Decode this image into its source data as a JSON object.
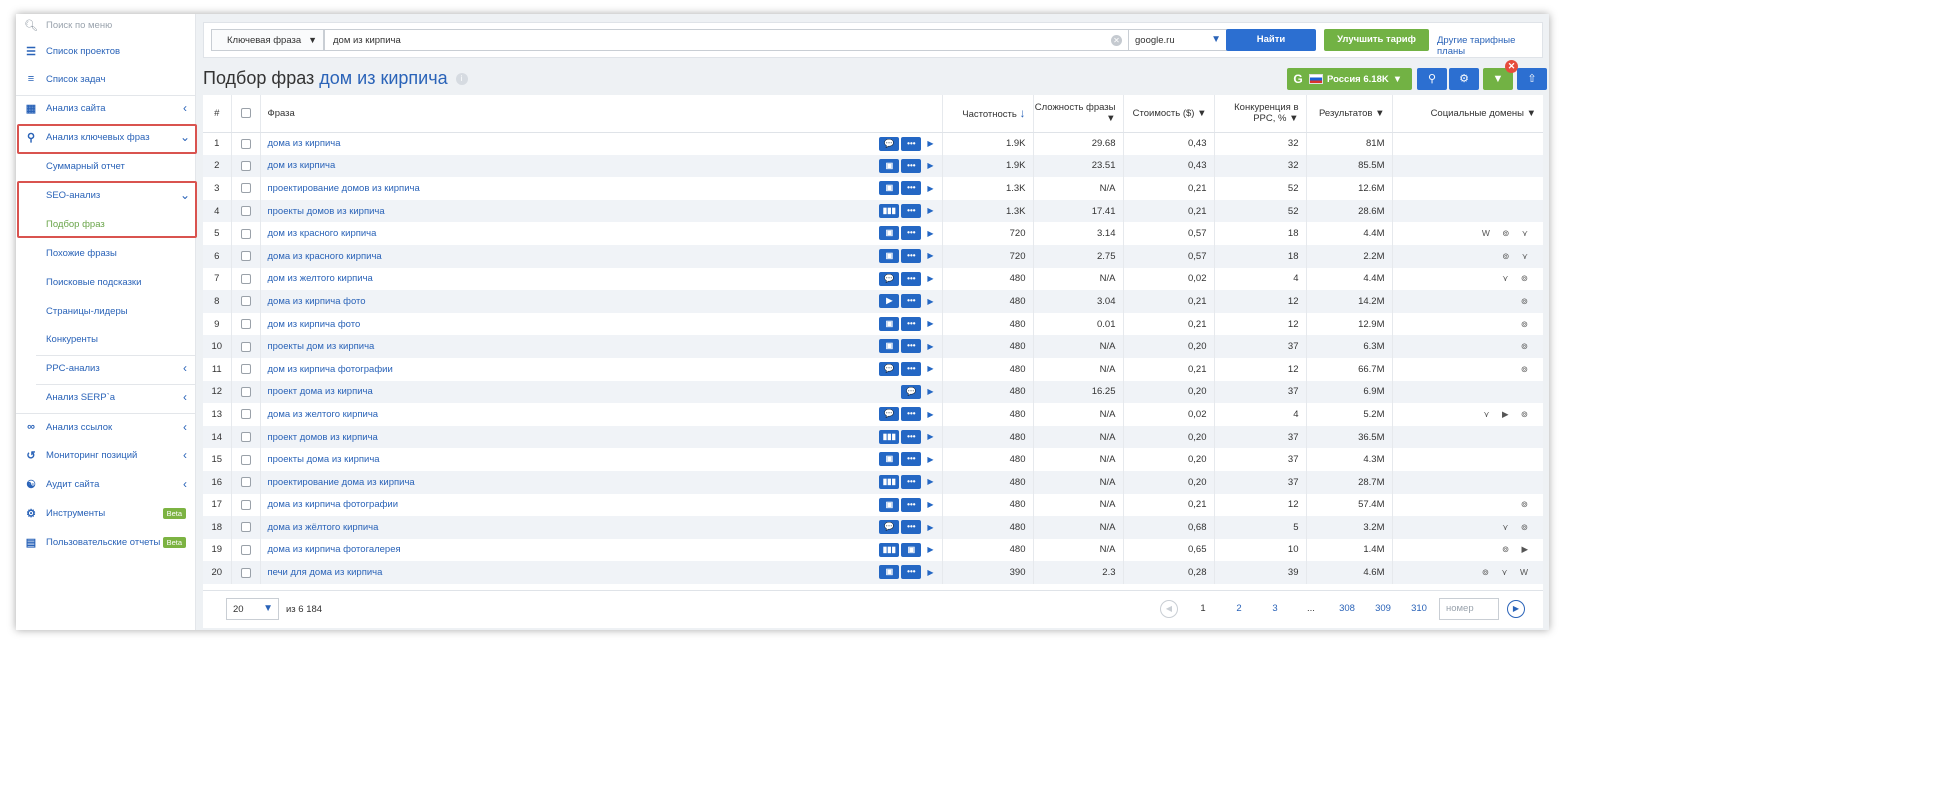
{
  "sidebar": {
    "search_placeholder": "Поиск по меню",
    "items": [
      {
        "label": "Список проектов",
        "icon": "list-icon"
      },
      {
        "label": "Список задач",
        "icon": "tasks-icon"
      },
      {
        "label": "Анализ сайта",
        "icon": "site-analysis-icon"
      },
      {
        "label": "Анализ ключевых фраз",
        "icon": "key-icon"
      },
      {
        "label": "Суммарный отчет"
      },
      {
        "label": "SEO-анализ"
      },
      {
        "label": "Подбор фраз"
      },
      {
        "label": "Похожие фразы"
      },
      {
        "label": "Поисковые подсказки"
      },
      {
        "label": "Страницы-лидеры"
      },
      {
        "label": "Конкуренты"
      },
      {
        "label": "PPC-анализ"
      },
      {
        "label": "Анализ SERP`а"
      },
      {
        "label": "Анализ ссылок",
        "icon": "link-icon"
      },
      {
        "label": "Мониторинг позиций",
        "icon": "history-icon"
      },
      {
        "label": "Аудит сайта",
        "icon": "sitemap-icon"
      },
      {
        "label": "Инструменты",
        "icon": "gear-icon",
        "badge": "Beta"
      },
      {
        "label": "Пользовательские отчеты",
        "icon": "report-icon",
        "badge": "Beta"
      }
    ]
  },
  "topbar": {
    "query_type": "Ключевая фраза",
    "query": "дом из кирпича",
    "database": "google.ru",
    "find_label": "Найти",
    "upgrade_label": "Улучшить тариф",
    "plans_label": "Другие тарифные планы"
  },
  "header": {
    "title": "Подбор фраз",
    "keyword": "дом из кирпича",
    "region_label": "Россия 6.18K"
  },
  "table": {
    "columns": [
      "#",
      "Фраза",
      "Частотность",
      "Сложность фразы",
      "Стоимость ($)",
      "Конкуренция в PPC, %",
      "Результатов",
      "Социальные домены"
    ],
    "rows": [
      {
        "n": "1",
        "phrase": "дома из кирпича",
        "freq": "1.9K",
        "diff": "29.68",
        "cost": "0,43",
        "comp": "32",
        "results": "81M",
        "social": "",
        "icons": [
          "💬",
          "•••"
        ]
      },
      {
        "n": "2",
        "phrase": "дом из кирпича",
        "freq": "1.9K",
        "diff": "23.51",
        "cost": "0,43",
        "comp": "32",
        "results": "85.5M",
        "social": "",
        "icons": [
          "▣",
          "•••"
        ]
      },
      {
        "n": "3",
        "phrase": "проектирование домов из кирпича",
        "freq": "1.3K",
        "diff": "N/A",
        "cost": "0,21",
        "comp": "52",
        "results": "12.6M",
        "social": "",
        "icons": [
          "▣",
          "•••"
        ]
      },
      {
        "n": "4",
        "phrase": "проекты домов из кирпича",
        "freq": "1.3K",
        "diff": "17.41",
        "cost": "0,21",
        "comp": "52",
        "results": "28.6M",
        "social": "",
        "icons": [
          "▮▮▮",
          "•••"
        ]
      },
      {
        "n": "5",
        "phrase": "дом из красного кирпича",
        "freq": "720",
        "diff": "3.14",
        "cost": "0,57",
        "comp": "18",
        "results": "4.4M",
        "social": "W ⊚ ⋎",
        "icons": [
          "▣",
          "•••"
        ]
      },
      {
        "n": "6",
        "phrase": "дома из красного кирпича",
        "freq": "720",
        "diff": "2.75",
        "cost": "0,57",
        "comp": "18",
        "results": "2.2M",
        "social": "⊚ ⋎",
        "icons": [
          "▣",
          "•••"
        ]
      },
      {
        "n": "7",
        "phrase": "дом из желтого кирпича",
        "freq": "480",
        "diff": "N/A",
        "cost": "0,02",
        "comp": "4",
        "results": "4.4M",
        "social": "⋎ ⊚",
        "icons": [
          "💬",
          "•••"
        ]
      },
      {
        "n": "8",
        "phrase": "дома из кирпича фото",
        "freq": "480",
        "diff": "3.04",
        "cost": "0,21",
        "comp": "12",
        "results": "14.2M",
        "social": "⊚",
        "icons": [
          "▶",
          "•••"
        ]
      },
      {
        "n": "9",
        "phrase": "дом из кирпича фото",
        "freq": "480",
        "diff": "0.01",
        "cost": "0,21",
        "comp": "12",
        "results": "12.9M",
        "social": "⊚",
        "icons": [
          "▣",
          "•••"
        ]
      },
      {
        "n": "10",
        "phrase": "проекты дом из кирпича",
        "freq": "480",
        "diff": "N/A",
        "cost": "0,20",
        "comp": "37",
        "results": "6.3M",
        "social": "⊚",
        "icons": [
          "▣",
          "•••"
        ]
      },
      {
        "n": "11",
        "phrase": "дом из кирпича фотографии",
        "freq": "480",
        "diff": "N/A",
        "cost": "0,21",
        "comp": "12",
        "results": "66.7M",
        "social": "⊚",
        "icons": [
          "💬",
          "•••"
        ]
      },
      {
        "n": "12",
        "phrase": "проект дома из кирпича",
        "freq": "480",
        "diff": "16.25",
        "cost": "0,20",
        "comp": "37",
        "results": "6.9M",
        "social": "",
        "icons": [
          "💬"
        ]
      },
      {
        "n": "13",
        "phrase": "дома из желтого кирпича",
        "freq": "480",
        "diff": "N/A",
        "cost": "0,02",
        "comp": "4",
        "results": "5.2M",
        "social": "⋎ ▶ ⊚",
        "icons": [
          "💬",
          "•••"
        ]
      },
      {
        "n": "14",
        "phrase": "проект домов из кирпича",
        "freq": "480",
        "diff": "N/A",
        "cost": "0,20",
        "comp": "37",
        "results": "36.5M",
        "social": "",
        "icons": [
          "▮▮▮",
          "•••"
        ]
      },
      {
        "n": "15",
        "phrase": "проекты дома из кирпича",
        "freq": "480",
        "diff": "N/A",
        "cost": "0,20",
        "comp": "37",
        "results": "4.3M",
        "social": "",
        "icons": [
          "▣",
          "•••"
        ]
      },
      {
        "n": "16",
        "phrase": "проектирование дома из кирпича",
        "freq": "480",
        "diff": "N/A",
        "cost": "0,20",
        "comp": "37",
        "results": "28.7M",
        "social": "",
        "icons": [
          "▮▮▮",
          "•••"
        ]
      },
      {
        "n": "17",
        "phrase": "дома из кирпича фотографии",
        "freq": "480",
        "diff": "N/A",
        "cost": "0,21",
        "comp": "12",
        "results": "57.4M",
        "social": "⊚",
        "icons": [
          "▣",
          "•••"
        ]
      },
      {
        "n": "18",
        "phrase": "дома из жёлтого кирпича",
        "freq": "480",
        "diff": "N/A",
        "cost": "0,68",
        "comp": "5",
        "results": "3.2M",
        "social": "⋎ ⊚",
        "icons": [
          "💬",
          "•••"
        ]
      },
      {
        "n": "19",
        "phrase": "дома из кирпича фотогалерея",
        "freq": "480",
        "diff": "N/A",
        "cost": "0,65",
        "comp": "10",
        "results": "1.4M",
        "social": "⊚ ▶",
        "icons": [
          "▮▮▮",
          "▣"
        ]
      },
      {
        "n": "20",
        "phrase": "печи для дома из кирпича",
        "freq": "390",
        "diff": "2.3",
        "cost": "0,28",
        "comp": "39",
        "results": "4.6M",
        "social": "⊚ ⋎ W",
        "icons": [
          "▣",
          "•••"
        ]
      }
    ]
  },
  "footer": {
    "per_page": "20",
    "of_total": "из 6 184",
    "pages": [
      "1",
      "2",
      "3",
      "...",
      "308",
      "309",
      "310"
    ],
    "page_input_placeholder": "номер"
  },
  "colors": {
    "accent_blue": "#2c6fd1",
    "accent_green": "#72b244",
    "highlight_red": "#d9534f"
  }
}
